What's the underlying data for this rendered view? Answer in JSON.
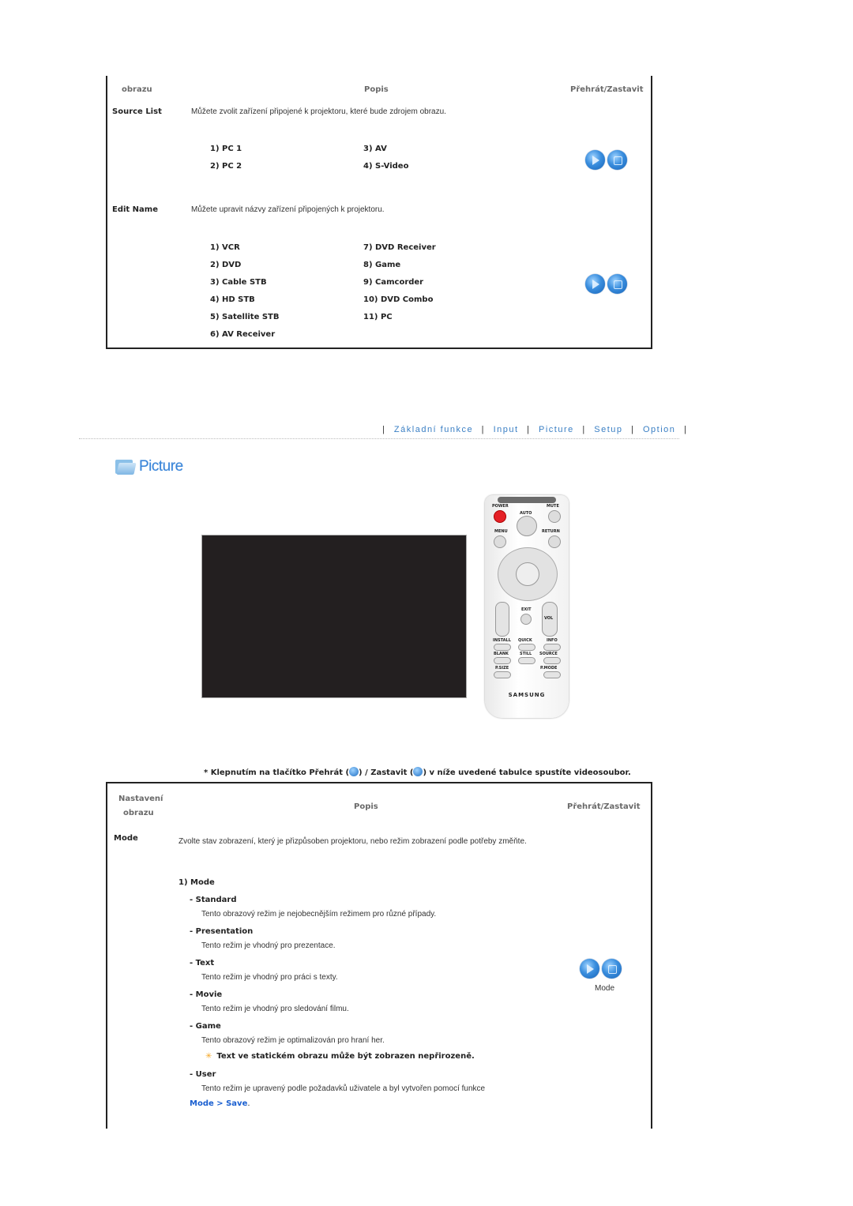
{
  "table1": {
    "headers": {
      "setting": "obrazu",
      "description": "Popis",
      "play_stop": "Přehrát/Zastavit"
    },
    "rows": [
      {
        "label": "Source List",
        "description": "Můžete zvolit zařízení připojené k projektoru, které bude zdrojem obrazu.",
        "items_col1": [
          "1) PC 1",
          "2) PC 2"
        ],
        "items_col2": [
          "3) AV",
          "4) S-Video"
        ]
      },
      {
        "label": "Edit Name",
        "description": "Můžete upravit názvy zařízení připojených k projektoru.",
        "items_col1": [
          "1) VCR",
          "2) DVD",
          "3) Cable STB",
          "4) HD STB",
          "5) Satellite STB",
          "6) AV Receiver"
        ],
        "items_col2": [
          "7) DVD Receiver",
          "8) Game",
          "9) Camcorder",
          "10) DVD Combo",
          "11) PC"
        ]
      }
    ]
  },
  "nav": {
    "items": [
      "Základní funkce",
      "Input",
      "Picture",
      "Setup",
      "Option"
    ],
    "separator": "|"
  },
  "section": {
    "title": "Picture",
    "icon": "folder-icon"
  },
  "remote": {
    "labels": [
      "POWER",
      "MUTE",
      "AUTO",
      "MENU",
      "RETURN",
      "EXIT",
      "VOL",
      "INSTALL",
      "QUICK",
      "INFO",
      "BLANK",
      "STILL",
      "SOURCE",
      "P.SIZE",
      "P.MODE"
    ],
    "brand": "SAMSUNG"
  },
  "note": {
    "prefix": "* Klepnutím na tlačítko Přehrát (",
    "middle": ") / Zastavit (",
    "suffix": ") v níže uvedené tabulce spustíte videosoubor."
  },
  "table2": {
    "headers": {
      "setting_line1": "Nastavení",
      "setting_line2": "obrazu",
      "description": "Popis",
      "play_stop": "Přehrát/Zastavit"
    },
    "row": {
      "label": "Mode",
      "description": "Zvolte stav zobrazení, který je přizpůsoben projektoru, nebo režim zobrazení podle potřeby změňte.",
      "subheading": "1) Mode",
      "modes": [
        {
          "name": "- Standard",
          "text": "Tento obrazový režim je nejobecnějším režimem pro různé případy."
        },
        {
          "name": "- Presentation",
          "text": "Tento režim je vhodný pro prezentace."
        },
        {
          "name": "- Text",
          "text": "Tento režim je vhodný pro práci s texty."
        },
        {
          "name": "- Movie",
          "text": "Tento režim je vhodný pro sledování filmu."
        },
        {
          "name": "- Game",
          "text": "Tento obrazový režim je optimalizován pro hraní her."
        }
      ],
      "warning": "Text ve statickém obrazu může být zobrazen nepřirozeně.",
      "user_mode": {
        "name": "- User",
        "text": "Tento režim je upravený podle požadavků uživatele a byl vytvořen pomocí funkce"
      },
      "link": "Mode > Save",
      "link_suffix": ".",
      "button_caption": "Mode"
    }
  }
}
